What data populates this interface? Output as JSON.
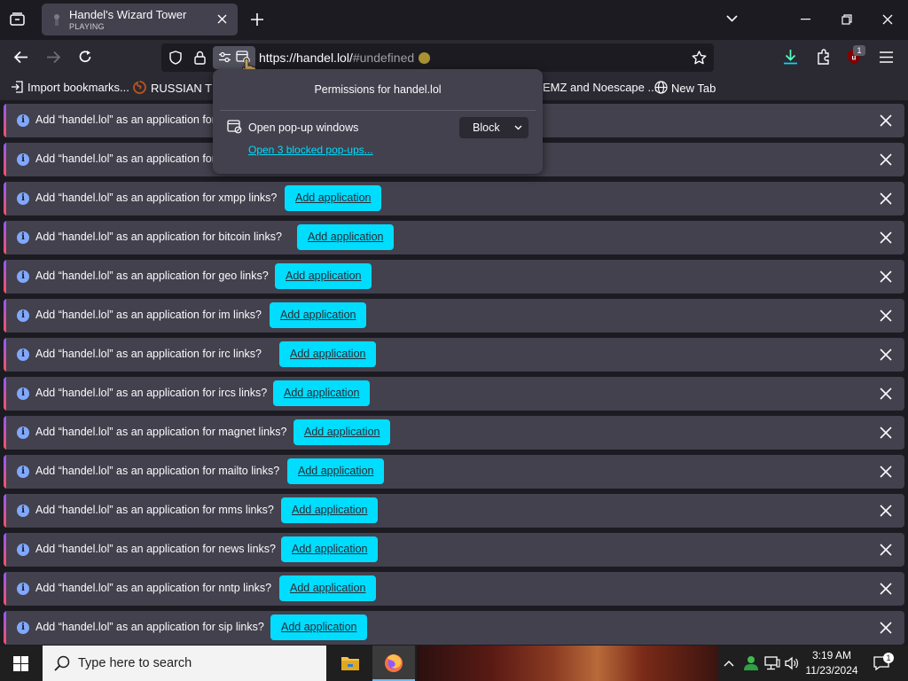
{
  "tab": {
    "title": "Handel's Wizard Tower",
    "status": "PLAYING"
  },
  "urlbar": {
    "url_host": "https://handel.lol/",
    "url_rest": "#undefined"
  },
  "extensions": {
    "badge": "1"
  },
  "bookmarks": [
    {
      "label": "Import bookmarks..."
    },
    {
      "label": "RUSSIAN TES"
    },
    {
      "label": "EMZ and Noescape ..."
    },
    {
      "label": "New Tab"
    }
  ],
  "permissions_panel": {
    "title": "Permissions for handel.lol",
    "permission_label": "Open pop-up windows",
    "permission_value": "Block",
    "blocked_link": "Open 3 blocked pop-ups..."
  },
  "notification_button_label": "Add application",
  "notifications": [
    {
      "message": "Add “handel.lol” as an application for",
      "show_button": false
    },
    {
      "message": "Add “handel.lol” as an application for",
      "show_button": false
    },
    {
      "message": "Add “handel.lol” as an application for xmpp links?",
      "show_button": true
    },
    {
      "message": "Add “handel.lol” as an application for bitcoin links?",
      "show_button": true
    },
    {
      "message": "Add “handel.lol” as an application for geo links?",
      "show_button": true
    },
    {
      "message": "Add “handel.lol” as an application for im links?",
      "show_button": true
    },
    {
      "message": "Add “handel.lol” as an application for irc links?",
      "show_button": true
    },
    {
      "message": "Add “handel.lol” as an application for ircs links?",
      "show_button": true
    },
    {
      "message": "Add “handel.lol” as an application for magnet links?",
      "show_button": true
    },
    {
      "message": "Add “handel.lol” as an application for mailto links?",
      "show_button": true
    },
    {
      "message": "Add “handel.lol” as an application for mms links?",
      "show_button": true
    },
    {
      "message": "Add “handel.lol” as an application for news links?",
      "show_button": true
    },
    {
      "message": "Add “handel.lol” as an application for nntp links?",
      "show_button": true
    },
    {
      "message": "Add “handel.lol” as an application for sip links?",
      "show_button": true
    }
  ],
  "taskbar": {
    "search_placeholder": "Type here to search",
    "time": "3:19 AM",
    "date": "11/23/2024"
  }
}
